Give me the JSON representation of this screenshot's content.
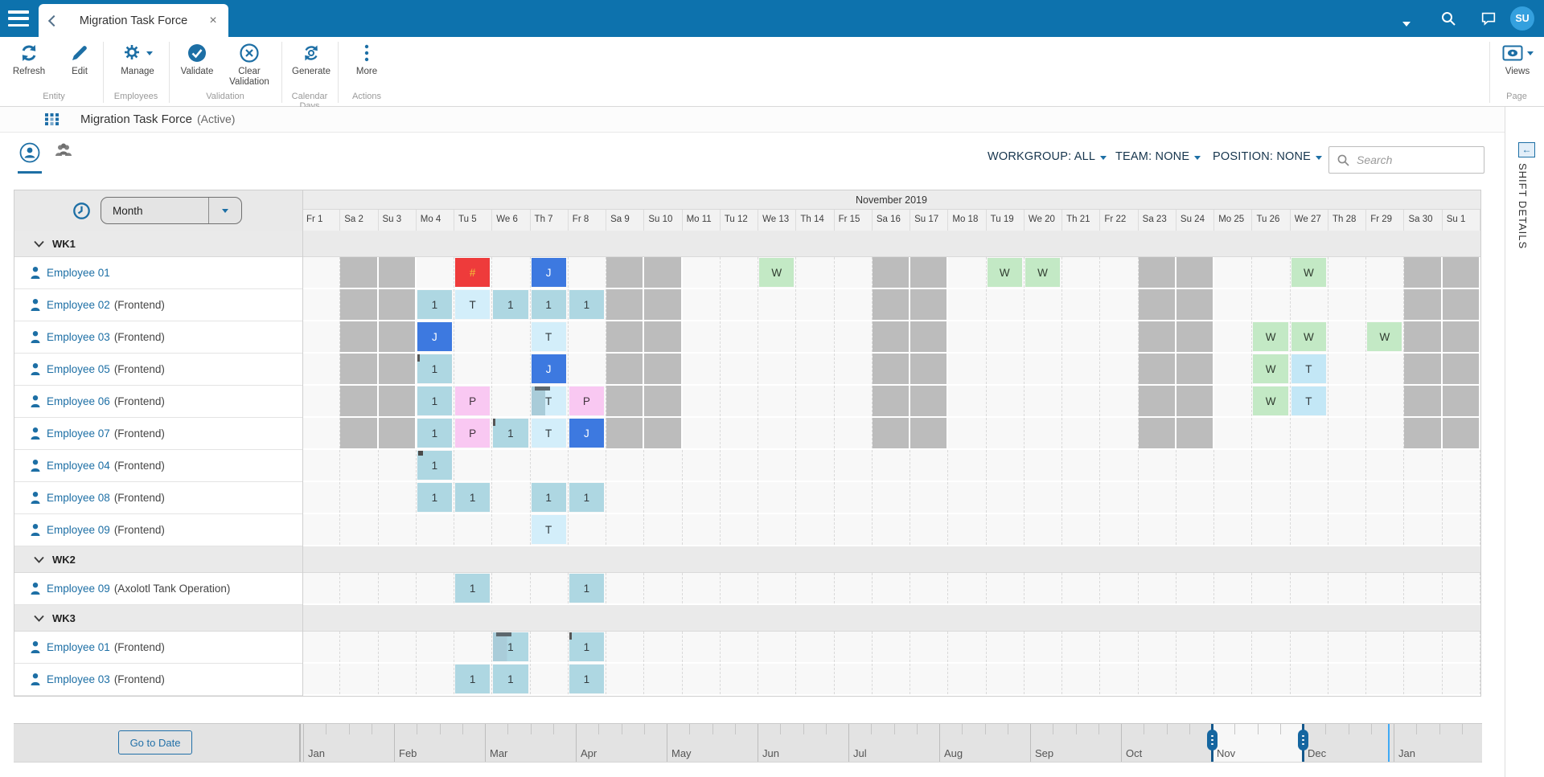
{
  "topbar": {
    "tab_title": "Migration Task Force",
    "avatar_initials": "SU"
  },
  "ribbon": {
    "groups": [
      {
        "label": "Entity",
        "buttons": [
          {
            "label": "Refresh"
          },
          {
            "label": "Edit"
          }
        ]
      },
      {
        "label": "Employees",
        "buttons": [
          {
            "label": "Manage"
          }
        ]
      },
      {
        "label": "Validation",
        "buttons": [
          {
            "label": "Validate"
          },
          {
            "label": "Clear Validation"
          }
        ]
      },
      {
        "label": "Calendar Days",
        "buttons": [
          {
            "label": "Generate"
          }
        ]
      },
      {
        "label": "Actions",
        "buttons": [
          {
            "label": "More"
          }
        ]
      }
    ],
    "page_group": {
      "label": "Page",
      "views_label": "Views"
    }
  },
  "entity": {
    "title": "Migration Task Force",
    "status": "(Active)"
  },
  "filters": {
    "workgroup": "WORKGROUP: ALL",
    "team": "TEAM: NONE",
    "position": "POSITION: NONE",
    "search_placeholder": "Search"
  },
  "shift_details": {
    "label": "SHIFT DETAILS"
  },
  "schedule": {
    "view_selector": "Month",
    "month_title": "November 2019",
    "days": [
      "Fr 1",
      "Sa 2",
      "Su 3",
      "Mo 4",
      "Tu 5",
      "We 6",
      "Th 7",
      "Fr 8",
      "Sa 9",
      "Su 10",
      "Mo 11",
      "Tu 12",
      "We 13",
      "Th 14",
      "Fr 15",
      "Sa 16",
      "Su 17",
      "Mo 18",
      "Tu 19",
      "We 20",
      "Th 21",
      "Fr 22",
      "Sa 23",
      "Su 24",
      "Mo 25",
      "Tu 26",
      "We 27",
      "Th 28",
      "Fr 29",
      "Sa 30",
      "Su 1"
    ],
    "weekend_indices": [
      1,
      2,
      8,
      9,
      15,
      16,
      22,
      23,
      29,
      30
    ],
    "colors": {
      "weekend_bg": "#bcbcbc",
      "empty_bg": "#f8f8f8",
      "split_overlay": "#a9ccd9",
      "marker": "#5d686e",
      "accent_blue": "#1d6fa5"
    },
    "cell_types": {
      "1": {
        "label": "1",
        "bg": "#aed7e2",
        "fg": "#333b3f"
      },
      "T": {
        "label": "T",
        "bg": "#d3eefa",
        "fg": "#333b3f"
      },
      "T2": {
        "label": "T",
        "bg": "#c3e7f6",
        "fg": "#333b3f"
      },
      "P": {
        "label": "P",
        "bg": "#f9c8f2",
        "fg": "#43343f"
      },
      "J": {
        "label": "J",
        "bg": "#3d79e0",
        "fg": "#ffffff"
      },
      "W": {
        "label": "W",
        "bg": "#c3e9c5",
        "fg": "#2f3b2f"
      },
      "R": {
        "label": "#",
        "bg": "#ee3b3b",
        "fg": "#f3c13a"
      }
    },
    "groups": [
      {
        "name": "WK1",
        "rows": [
          {
            "employee": "Employee 01",
            "role": "",
            "weekend_shading": true,
            "cells": [
              {
                "i": 4,
                "t": "R"
              },
              {
                "i": 6,
                "t": "J"
              },
              {
                "i": 12,
                "t": "W"
              },
              {
                "i": 18,
                "t": "W"
              },
              {
                "i": 19,
                "t": "W"
              },
              {
                "i": 26,
                "t": "W"
              }
            ]
          },
          {
            "employee": "Employee 02",
            "role": "(Frontend)",
            "weekend_shading": true,
            "cells": [
              {
                "i": 3,
                "t": "1"
              },
              {
                "i": 4,
                "t": "T"
              },
              {
                "i": 5,
                "t": "1"
              },
              {
                "i": 6,
                "t": "1"
              },
              {
                "i": 7,
                "t": "1"
              }
            ]
          },
          {
            "employee": "Employee 03",
            "role": "(Frontend)",
            "weekend_shading": true,
            "cells": [
              {
                "i": 3,
                "t": "J"
              },
              {
                "i": 6,
                "t": "T"
              },
              {
                "i": 25,
                "t": "W"
              },
              {
                "i": 26,
                "t": "W"
              },
              {
                "i": 28,
                "t": "W"
              }
            ]
          },
          {
            "employee": "Employee 05",
            "role": "(Frontend)",
            "weekend_shading": true,
            "cells": [
              {
                "i": 3,
                "t": "1",
                "m": "tick"
              },
              {
                "i": 6,
                "t": "J"
              },
              {
                "i": 25,
                "t": "W"
              },
              {
                "i": 26,
                "t": "T2"
              }
            ]
          },
          {
            "employee": "Employee 06",
            "role": "(Frontend)",
            "weekend_shading": true,
            "cells": [
              {
                "i": 3,
                "t": "1"
              },
              {
                "i": 4,
                "t": "P"
              },
              {
                "i": 6,
                "t": "T",
                "m": "topbar",
                "split": true
              },
              {
                "i": 7,
                "t": "P"
              },
              {
                "i": 25,
                "t": "W"
              },
              {
                "i": 26,
                "t": "T2"
              }
            ]
          },
          {
            "employee": "Employee 07",
            "role": "(Frontend)",
            "weekend_shading": true,
            "cells": [
              {
                "i": 3,
                "t": "1"
              },
              {
                "i": 4,
                "t": "P"
              },
              {
                "i": 5,
                "t": "1",
                "m": "tick"
              },
              {
                "i": 6,
                "t": "T"
              },
              {
                "i": 7,
                "t": "J"
              }
            ]
          },
          {
            "employee": "Employee 04",
            "role": "(Frontend)",
            "weekend_shading": false,
            "cells": [
              {
                "i": 3,
                "t": "1",
                "m": "corner"
              }
            ]
          },
          {
            "employee": "Employee 08",
            "role": "(Frontend)",
            "weekend_shading": false,
            "cells": [
              {
                "i": 3,
                "t": "1"
              },
              {
                "i": 4,
                "t": "1"
              },
              {
                "i": 6,
                "t": "1"
              },
              {
                "i": 7,
                "t": "1"
              }
            ]
          },
          {
            "employee": "Employee 09",
            "role": "(Frontend)",
            "weekend_shading": false,
            "cells": [
              {
                "i": 6,
                "t": "T"
              }
            ]
          }
        ]
      },
      {
        "name": "WK2",
        "rows": [
          {
            "employee": "Employee 09",
            "role": "(Axolotl Tank Operation)",
            "weekend_shading": false,
            "cells": [
              {
                "i": 4,
                "t": "1"
              },
              {
                "i": 7,
                "t": "1"
              }
            ]
          }
        ]
      },
      {
        "name": "WK3",
        "rows": [
          {
            "employee": "Employee 01",
            "role": "(Frontend)",
            "weekend_shading": false,
            "cells": [
              {
                "i": 5,
                "t": "1",
                "m": "topbar",
                "split": true
              },
              {
                "i": 7,
                "t": "1",
                "m": "tick"
              }
            ]
          },
          {
            "employee": "Employee 03",
            "role": "(Frontend)",
            "weekend_shading": false,
            "cells": [
              {
                "i": 4,
                "t": "1"
              },
              {
                "i": 5,
                "t": "1"
              },
              {
                "i": 7,
                "t": "1"
              }
            ]
          }
        ]
      }
    ]
  },
  "timeline": {
    "go_to_date_label": "Go to Date",
    "months": [
      "Jan",
      "Feb",
      "Mar",
      "Apr",
      "May",
      "Jun",
      "Jul",
      "Aug",
      "Sep",
      "Oct",
      "Nov",
      "Dec",
      "Jan"
    ],
    "range_start_month_index": 10,
    "range_end_month_index": 11
  }
}
